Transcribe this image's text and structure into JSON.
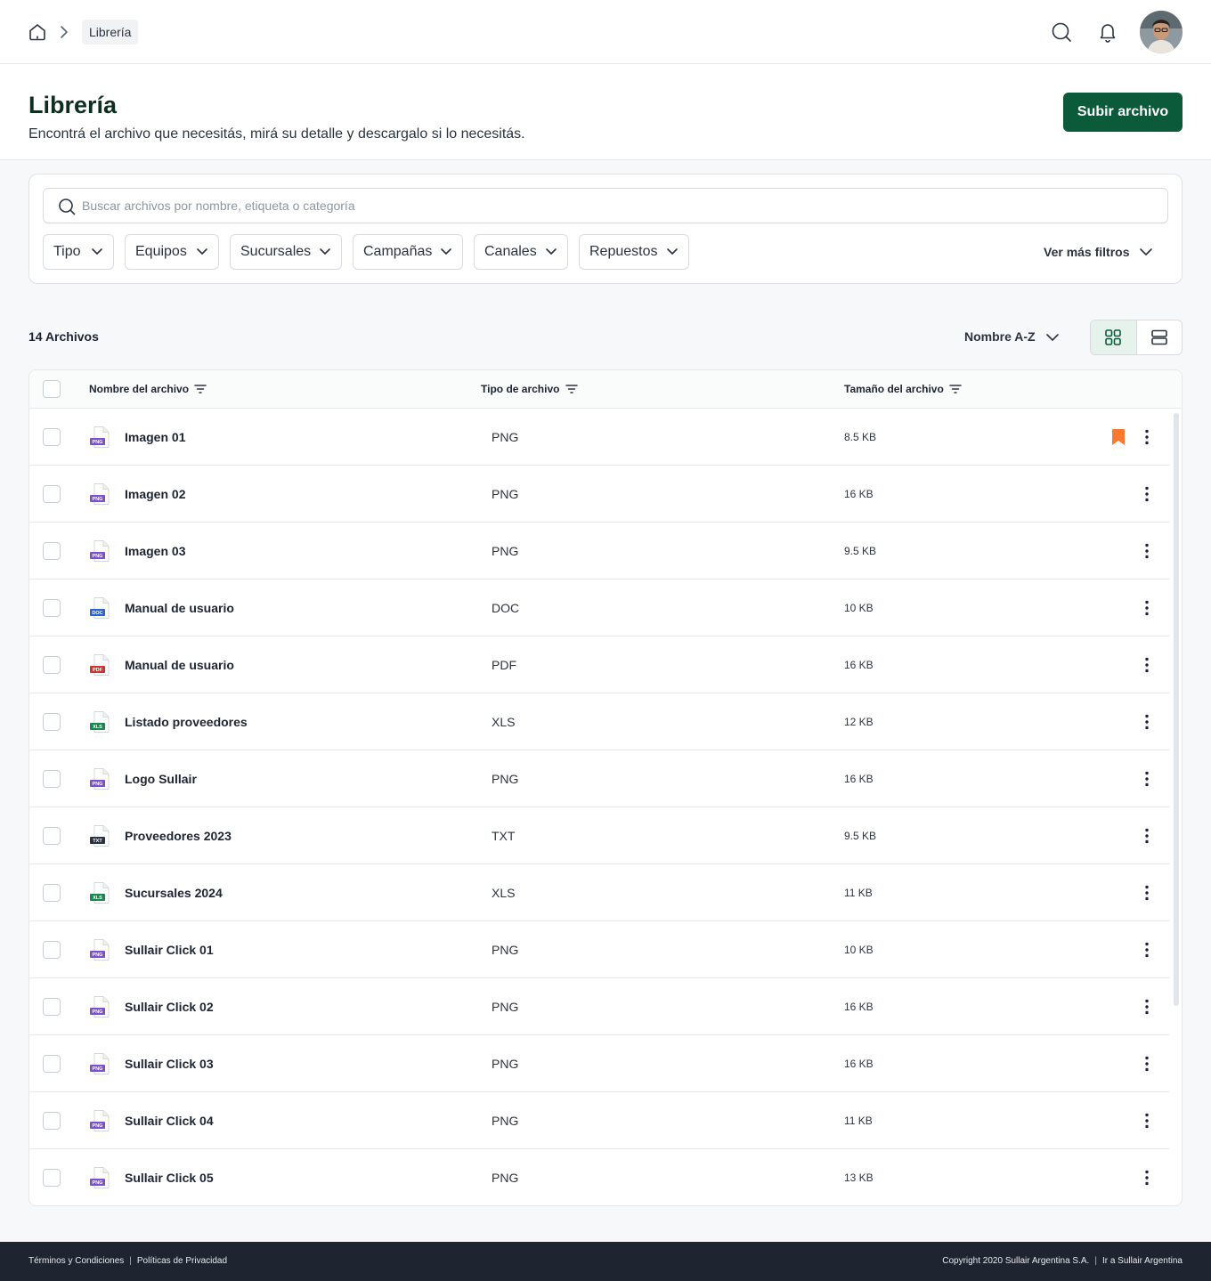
{
  "breadcrumb": {
    "current": "Librería"
  },
  "header": {
    "title": "Librería",
    "subtitle": "Encontrá el archivo que necesitás, mirá su detalle y descargalo si lo necesitás.",
    "upload_label": "Subir archivo"
  },
  "search": {
    "placeholder": "Buscar archivos por nombre, etiqueta o categoría"
  },
  "filters": {
    "chips": [
      "Tipo",
      "Equipos",
      "Sucursales",
      "Campañas",
      "Canales",
      "Repuestos"
    ],
    "more_label": "Ver más filtros"
  },
  "results": {
    "count_label": "14 Archivos",
    "sort_label": "Nombre A-Z",
    "view_mode": "grid"
  },
  "table": {
    "columns": [
      "Nombre del archivo",
      "Tipo de archivo",
      "Tamaño del archivo"
    ],
    "rows": [
      {
        "name": "Imagen 01",
        "type": "PNG",
        "size": "8.5 KB",
        "bookmarked": true
      },
      {
        "name": "Imagen 02",
        "type": "PNG",
        "size": "16 KB",
        "bookmarked": false
      },
      {
        "name": "Imagen 03",
        "type": "PNG",
        "size": "9.5 KB",
        "bookmarked": false
      },
      {
        "name": "Manual de usuario",
        "type": "DOC",
        "size": "10 KB",
        "bookmarked": false
      },
      {
        "name": "Manual de usuario",
        "type": "PDF",
        "size": "16 KB",
        "bookmarked": false
      },
      {
        "name": "Listado proveedores",
        "type": "XLS",
        "size": "12 KB",
        "bookmarked": false
      },
      {
        "name": "Logo Sullair",
        "type": "PNG",
        "size": "16 KB",
        "bookmarked": false
      },
      {
        "name": "Proveedores 2023",
        "type": "TXT",
        "size": "9.5 KB",
        "bookmarked": false
      },
      {
        "name": "Sucursales 2024",
        "type": "XLS",
        "size": "11 KB",
        "bookmarked": false
      },
      {
        "name": "Sullair Click 01",
        "type": "PNG",
        "size": "10 KB",
        "bookmarked": false
      },
      {
        "name": "Sullair Click 02",
        "type": "PNG",
        "size": "16 KB",
        "bookmarked": false
      },
      {
        "name": "Sullair Click 03",
        "type": "PNG",
        "size": "16 KB",
        "bookmarked": false
      },
      {
        "name": "Sullair Click 04",
        "type": "PNG",
        "size": "11 KB",
        "bookmarked": false
      },
      {
        "name": "Sullair Click 05",
        "type": "PNG",
        "size": "13 KB",
        "bookmarked": false
      }
    ]
  },
  "file_type_colors": {
    "PNG": "#7b4fd6",
    "DOC": "#2563d6",
    "PDF": "#d6322b",
    "XLS": "#16894d",
    "TXT": "#2c3340"
  },
  "colors": {
    "primary": "#0b5a3a",
    "bookmark": "#f97a2f",
    "footer_bg": "#1e2430"
  },
  "footer": {
    "terms": "Términos y Condiciones",
    "privacy": "Políticas de Privacidad",
    "copyright": "Copyright 2020 Sullair Argentina S.A.",
    "link": "Ir a Sullair Argentina"
  }
}
